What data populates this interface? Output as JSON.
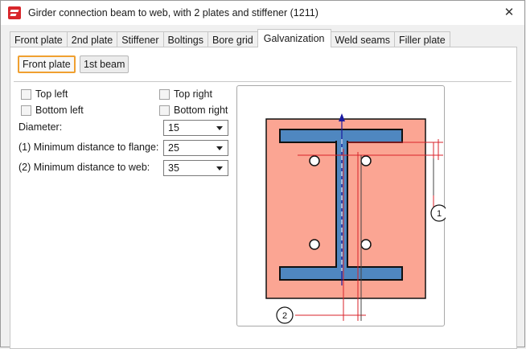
{
  "window": {
    "title": "Girder connection beam to web, with 2 plates and stiffener (1211)",
    "close_glyph": "✕"
  },
  "tabs": [
    {
      "label": "Front plate",
      "active": false
    },
    {
      "label": "2nd plate",
      "active": false
    },
    {
      "label": "Stiffener",
      "active": false
    },
    {
      "label": "Boltings",
      "active": false
    },
    {
      "label": "Bore grid",
      "active": false
    },
    {
      "label": "Galvanization",
      "active": true
    },
    {
      "label": "Weld seams",
      "active": false
    },
    {
      "label": "Filler plate",
      "active": false
    }
  ],
  "subtabs": {
    "front_plate": "Front plate",
    "first_beam": "1st beam"
  },
  "checkboxes": {
    "top_left": {
      "label": "Top left",
      "checked": false
    },
    "top_right": {
      "label": "Top right",
      "checked": false
    },
    "bottom_left": {
      "label": "Bottom left",
      "checked": false
    },
    "bottom_right": {
      "label": "Bottom right",
      "checked": false
    }
  },
  "fields": {
    "diameter": {
      "label": "Diameter:",
      "value": "15"
    },
    "min_flange": {
      "label": "(1) Minimum distance to flange:",
      "value": "25"
    },
    "min_web": {
      "label": "(2) Minimum distance to web:",
      "value": "35"
    }
  },
  "diagram": {
    "marker_1": "1",
    "marker_2": "2",
    "plate_color": "#fba593",
    "beam_color": "#4f87c0",
    "dimension_color": "#d8222a",
    "axis_color": "#1a1aa0"
  },
  "colors": {
    "accent": "#f0a030",
    "app_icon": "#d8262b"
  }
}
